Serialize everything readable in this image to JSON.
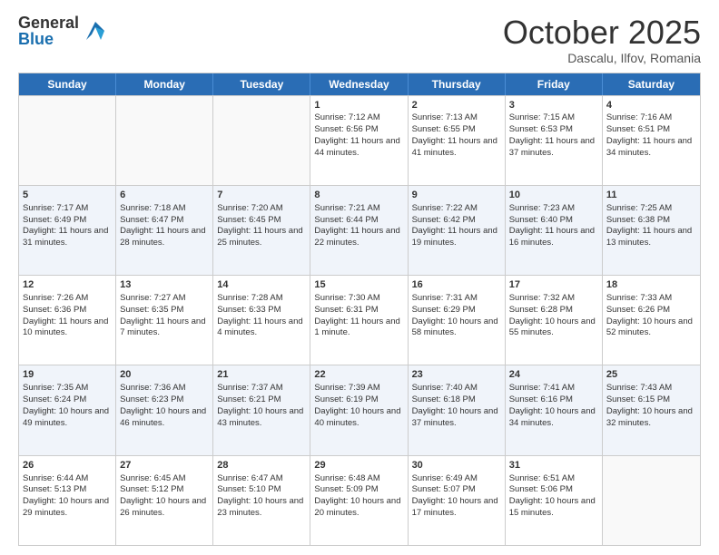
{
  "logo": {
    "general": "General",
    "blue": "Blue"
  },
  "title": "October 2025",
  "location": "Dascalu, Ilfov, Romania",
  "days": [
    "Sunday",
    "Monday",
    "Tuesday",
    "Wednesday",
    "Thursday",
    "Friday",
    "Saturday"
  ],
  "rows": [
    [
      {
        "day": "",
        "info": ""
      },
      {
        "day": "",
        "info": ""
      },
      {
        "day": "",
        "info": ""
      },
      {
        "day": "1",
        "info": "Sunrise: 7:12 AM\nSunset: 6:56 PM\nDaylight: 11 hours and 44 minutes."
      },
      {
        "day": "2",
        "info": "Sunrise: 7:13 AM\nSunset: 6:55 PM\nDaylight: 11 hours and 41 minutes."
      },
      {
        "day": "3",
        "info": "Sunrise: 7:15 AM\nSunset: 6:53 PM\nDaylight: 11 hours and 37 minutes."
      },
      {
        "day": "4",
        "info": "Sunrise: 7:16 AM\nSunset: 6:51 PM\nDaylight: 11 hours and 34 minutes."
      }
    ],
    [
      {
        "day": "5",
        "info": "Sunrise: 7:17 AM\nSunset: 6:49 PM\nDaylight: 11 hours and 31 minutes."
      },
      {
        "day": "6",
        "info": "Sunrise: 7:18 AM\nSunset: 6:47 PM\nDaylight: 11 hours and 28 minutes."
      },
      {
        "day": "7",
        "info": "Sunrise: 7:20 AM\nSunset: 6:45 PM\nDaylight: 11 hours and 25 minutes."
      },
      {
        "day": "8",
        "info": "Sunrise: 7:21 AM\nSunset: 6:44 PM\nDaylight: 11 hours and 22 minutes."
      },
      {
        "day": "9",
        "info": "Sunrise: 7:22 AM\nSunset: 6:42 PM\nDaylight: 11 hours and 19 minutes."
      },
      {
        "day": "10",
        "info": "Sunrise: 7:23 AM\nSunset: 6:40 PM\nDaylight: 11 hours and 16 minutes."
      },
      {
        "day": "11",
        "info": "Sunrise: 7:25 AM\nSunset: 6:38 PM\nDaylight: 11 hours and 13 minutes."
      }
    ],
    [
      {
        "day": "12",
        "info": "Sunrise: 7:26 AM\nSunset: 6:36 PM\nDaylight: 11 hours and 10 minutes."
      },
      {
        "day": "13",
        "info": "Sunrise: 7:27 AM\nSunset: 6:35 PM\nDaylight: 11 hours and 7 minutes."
      },
      {
        "day": "14",
        "info": "Sunrise: 7:28 AM\nSunset: 6:33 PM\nDaylight: 11 hours and 4 minutes."
      },
      {
        "day": "15",
        "info": "Sunrise: 7:30 AM\nSunset: 6:31 PM\nDaylight: 11 hours and 1 minute."
      },
      {
        "day": "16",
        "info": "Sunrise: 7:31 AM\nSunset: 6:29 PM\nDaylight: 10 hours and 58 minutes."
      },
      {
        "day": "17",
        "info": "Sunrise: 7:32 AM\nSunset: 6:28 PM\nDaylight: 10 hours and 55 minutes."
      },
      {
        "day": "18",
        "info": "Sunrise: 7:33 AM\nSunset: 6:26 PM\nDaylight: 10 hours and 52 minutes."
      }
    ],
    [
      {
        "day": "19",
        "info": "Sunrise: 7:35 AM\nSunset: 6:24 PM\nDaylight: 10 hours and 49 minutes."
      },
      {
        "day": "20",
        "info": "Sunrise: 7:36 AM\nSunset: 6:23 PM\nDaylight: 10 hours and 46 minutes."
      },
      {
        "day": "21",
        "info": "Sunrise: 7:37 AM\nSunset: 6:21 PM\nDaylight: 10 hours and 43 minutes."
      },
      {
        "day": "22",
        "info": "Sunrise: 7:39 AM\nSunset: 6:19 PM\nDaylight: 10 hours and 40 minutes."
      },
      {
        "day": "23",
        "info": "Sunrise: 7:40 AM\nSunset: 6:18 PM\nDaylight: 10 hours and 37 minutes."
      },
      {
        "day": "24",
        "info": "Sunrise: 7:41 AM\nSunset: 6:16 PM\nDaylight: 10 hours and 34 minutes."
      },
      {
        "day": "25",
        "info": "Sunrise: 7:43 AM\nSunset: 6:15 PM\nDaylight: 10 hours and 32 minutes."
      }
    ],
    [
      {
        "day": "26",
        "info": "Sunrise: 6:44 AM\nSunset: 5:13 PM\nDaylight: 10 hours and 29 minutes."
      },
      {
        "day": "27",
        "info": "Sunrise: 6:45 AM\nSunset: 5:12 PM\nDaylight: 10 hours and 26 minutes."
      },
      {
        "day": "28",
        "info": "Sunrise: 6:47 AM\nSunset: 5:10 PM\nDaylight: 10 hours and 23 minutes."
      },
      {
        "day": "29",
        "info": "Sunrise: 6:48 AM\nSunset: 5:09 PM\nDaylight: 10 hours and 20 minutes."
      },
      {
        "day": "30",
        "info": "Sunrise: 6:49 AM\nSunset: 5:07 PM\nDaylight: 10 hours and 17 minutes."
      },
      {
        "day": "31",
        "info": "Sunrise: 6:51 AM\nSunset: 5:06 PM\nDaylight: 10 hours and 15 minutes."
      },
      {
        "day": "",
        "info": ""
      }
    ]
  ]
}
